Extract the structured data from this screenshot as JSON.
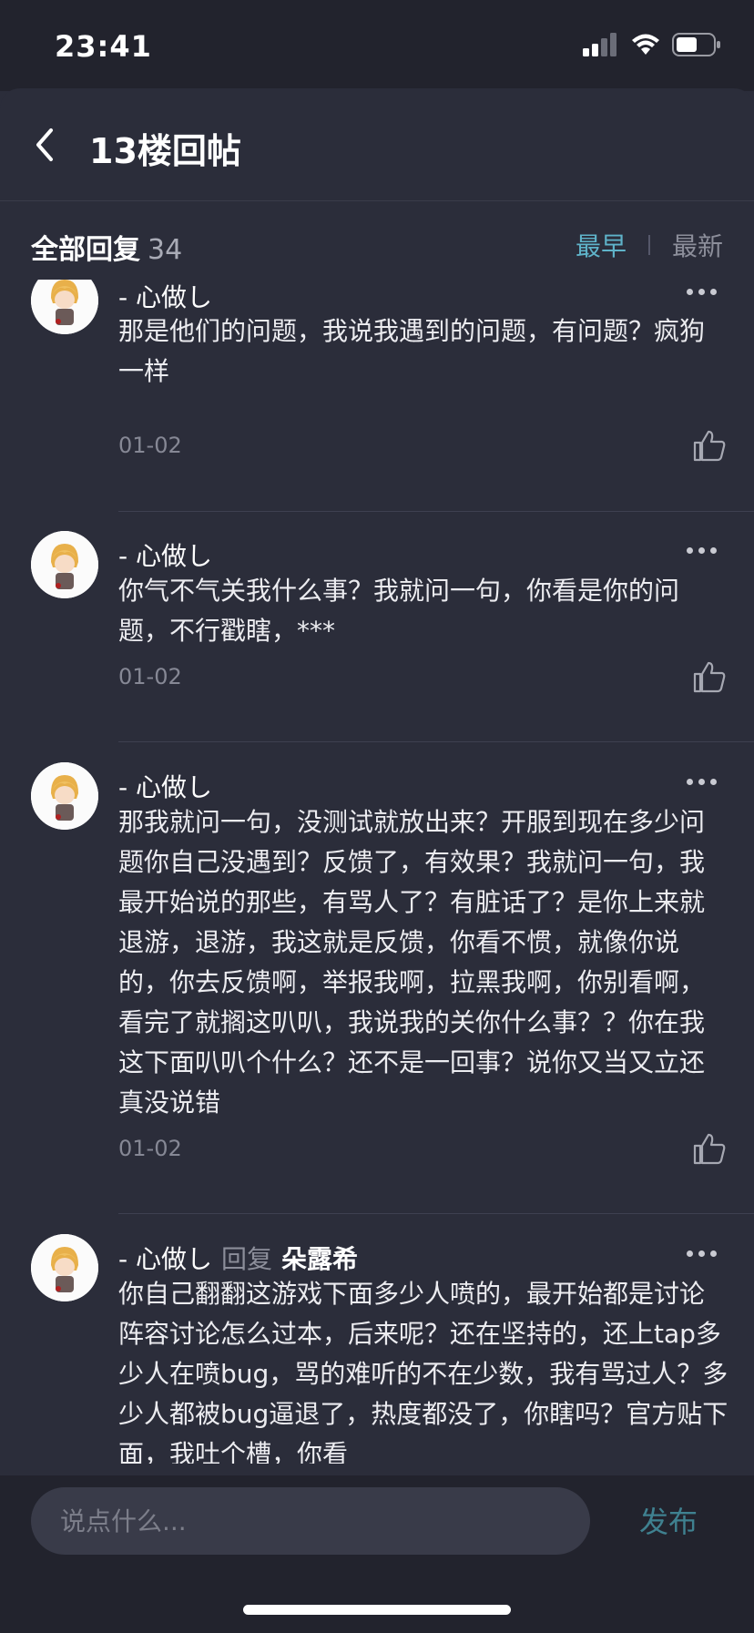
{
  "status_bar": {
    "time": "23:41"
  },
  "header": {
    "title": "13楼回帖"
  },
  "section": {
    "title": "全部回复",
    "count": "34",
    "sort_options": [
      "最早",
      "最新"
    ],
    "active_sort": "最早"
  },
  "comments": [
    {
      "user": "-   心做し",
      "text": "那是他们的问题，我说我遇到的问题，有问题？疯狗一样",
      "date": "01-02"
    },
    {
      "user": "-   心做し",
      "text": "你气不气关我什么事？我就问一句，你看是你的问题，不行戳瞎，***",
      "date": "01-02"
    },
    {
      "user": "-   心做し",
      "text": "那我就问一句，没测试就放出来？开服到现在多少问题你自己没遇到？反馈了，有效果？我就问一句，我最开始说的那些，有骂人了？有脏话了？是你上来就退游，退游，我这就是反馈，你看不惯，就像你说的，你去反馈啊，举报我啊，拉黑我啊，你别看啊，看完了就搁这叭叭，我说我的关你什么事？？你在我这下面叭叭个什么？还不是一回事？说你又当又立还真没说错",
      "date": "01-02"
    },
    {
      "user": "-   心做し",
      "reply_word": "回复",
      "reply_to": "朵露希",
      "text": "你自己翻翻这游戏下面多少人喷的，最开始都是讨论阵容讨论怎么过本，后来呢？还在坚持的，还上tap多少人在喷bug，骂的难听的不在少数，我有骂过人？多少人都被bug逼退了，热度都没了，你瞎吗？官方贴下面，我吐个槽，你看",
      "date": ""
    }
  ],
  "composer": {
    "placeholder": "说点什么...",
    "publish_label": "发布"
  },
  "colors": {
    "background": "#2b2d3a",
    "accent": "#5fb3c9",
    "publish": "#3f8190"
  },
  "icons": [
    "back-chevron-icon",
    "signal-icon",
    "wifi-icon",
    "battery-icon",
    "more-icon",
    "thumbs-up-icon",
    "avatar-image"
  ]
}
